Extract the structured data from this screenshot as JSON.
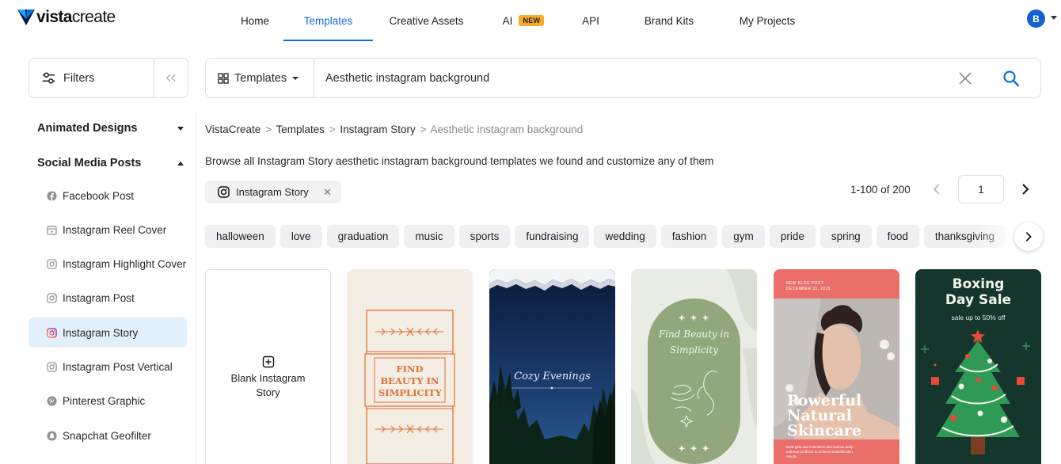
{
  "brand": {
    "name_bold": "vista",
    "name_light": "create"
  },
  "nav": {
    "items": [
      {
        "label": "Home"
      },
      {
        "label": "Templates"
      },
      {
        "label": "Creative Assets"
      },
      {
        "label": "AI",
        "badge": "NEW"
      },
      {
        "label": "API"
      },
      {
        "label": "Brand Kits"
      },
      {
        "label": "My Projects"
      }
    ],
    "active": "Templates",
    "avatar_letter": "B"
  },
  "filters": {
    "label": "Filters"
  },
  "search": {
    "type_label": "Templates",
    "query": "Aesthetic instagram background"
  },
  "sidebar": {
    "sections": [
      {
        "label": "Animated Designs",
        "expanded": false
      },
      {
        "label": "Social Media Posts",
        "expanded": true
      }
    ],
    "items": [
      {
        "label": "Facebook Post",
        "icon": "facebook-icon"
      },
      {
        "label": "Instagram Reel Cover",
        "icon": "reel-icon"
      },
      {
        "label": "Instagram Highlight Cover",
        "icon": "instagram-icon"
      },
      {
        "label": "Instagram Post",
        "icon": "instagram-icon"
      },
      {
        "label": "Instagram Story",
        "icon": "instagram-icon",
        "active": true
      },
      {
        "label": "Instagram Post Vertical",
        "icon": "instagram-icon"
      },
      {
        "label": "Pinterest Graphic",
        "icon": "pinterest-icon"
      },
      {
        "label": "Snapchat Geofilter",
        "icon": "snapchat-icon"
      }
    ]
  },
  "breadcrumb": {
    "items": [
      "VistaCreate",
      "Templates",
      "Instagram Story"
    ],
    "current": "Aesthetic instagram background",
    "separator": ">"
  },
  "subtitle": "Browse all Instagram Story aesthetic instagram background templates we found and customize any of them",
  "active_filter": {
    "label": "Instagram Story"
  },
  "pagination": {
    "range": "1-100 of 200",
    "page": "1"
  },
  "tags": [
    "halloween",
    "music",
    "graduation",
    "music",
    "sports",
    "fundraising",
    "wedding",
    "fashion",
    "gym",
    "pride",
    "spring",
    "food",
    "thanksgiving"
  ],
  "cards": {
    "blank_label": "Blank Instagram Story",
    "t1": {
      "text": "FIND BEAUTY IN SIMPLICITY"
    },
    "t2": {
      "text": "Cozy Evenings"
    },
    "t3": {
      "text": "Find Beauty in Simplicity"
    },
    "t4": {
      "kicker": "NEW BLOG POST",
      "date": "DECEMBER 31, 2025",
      "title_1": "Powerful",
      "title_2": "Natural",
      "title_3": "Skincare",
      "body": "Most girls use cosmetics and various daily makeup products to achieve beautiful skin results."
    },
    "t5": {
      "title_1": "Boxing",
      "title_2": "Day Sale",
      "sub": "sale up to 50% off"
    }
  },
  "colors": {
    "accent": "#0f6fdc",
    "badge": "#f7a928",
    "active_row": "#e1f0fb"
  }
}
